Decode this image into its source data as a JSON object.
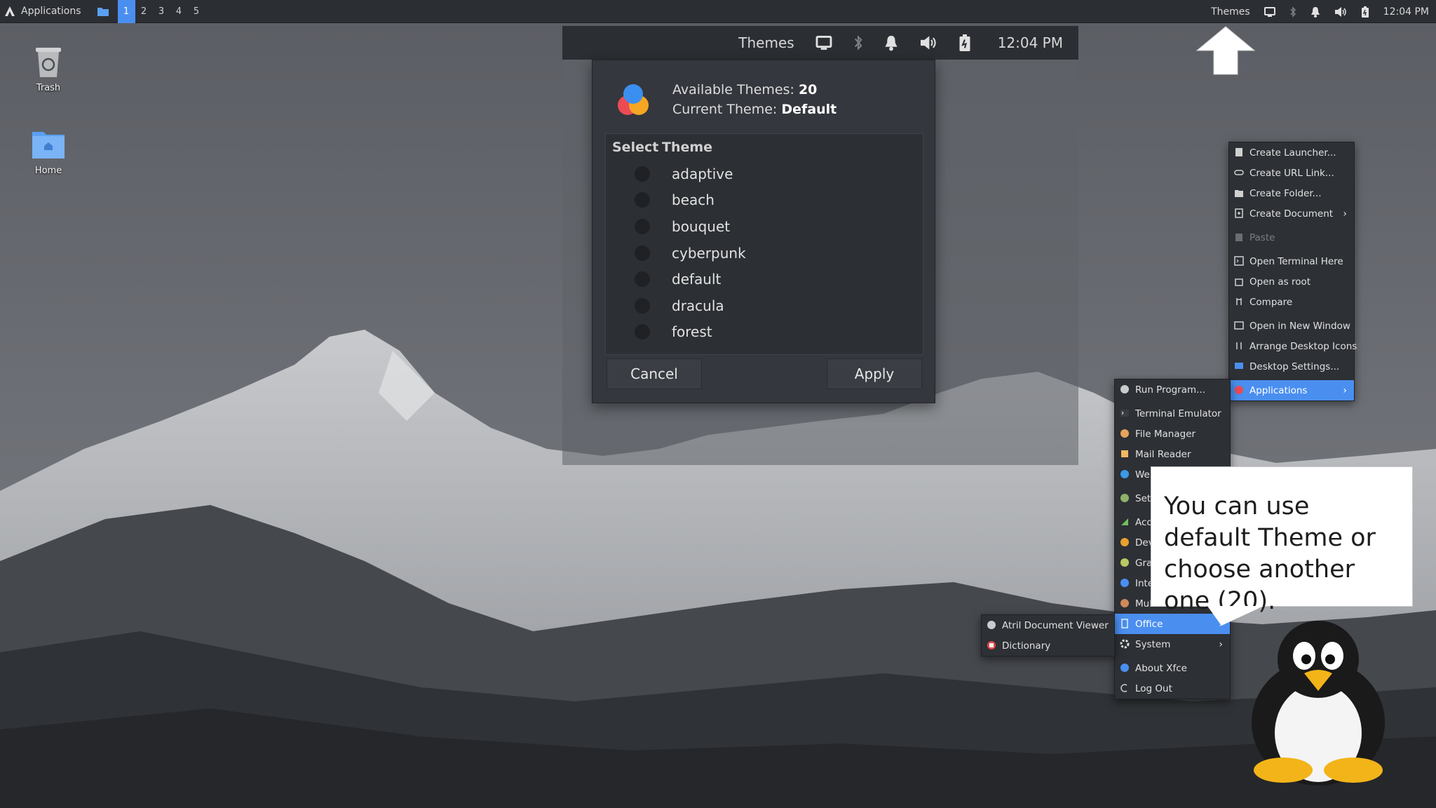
{
  "panel": {
    "applications_label": "Applications",
    "workspaces": [
      "1",
      "2",
      "3",
      "4",
      "5"
    ],
    "themes_label": "Themes",
    "clock": "12:04 PM",
    "icons": [
      "display-icon",
      "bluetooth-icon",
      "bell-icon",
      "volume-icon",
      "battery-icon"
    ]
  },
  "desktop": {
    "trash_label": "Trash",
    "home_label": "Home"
  },
  "zoom_panel": {
    "themes_label": "Themes",
    "clock": "12:04 PM"
  },
  "dialog": {
    "available_label": "Available Themes:",
    "available_count": "20",
    "current_label": "Current Theme:",
    "current_value": "Default",
    "col_select": "Select",
    "col_theme": "Theme",
    "themes": [
      "adaptive",
      "beach",
      "bouquet",
      "cyberpunk",
      "default",
      "dracula",
      "forest"
    ],
    "cancel_label": "Cancel",
    "apply_label": "Apply"
  },
  "desktop_menu": {
    "items": [
      {
        "label": "Create Launcher...",
        "icon": "launcher-icon"
      },
      {
        "label": "Create URL Link...",
        "icon": "link-icon"
      },
      {
        "label": "Create Folder...",
        "icon": "folder-icon"
      },
      {
        "label": "Create Document",
        "icon": "document-icon"
      },
      {
        "label": "Paste",
        "icon": "paste-icon"
      },
      {
        "label": "Open Terminal Here",
        "icon": "terminal-icon"
      },
      {
        "label": "Open as root",
        "icon": "root-icon"
      },
      {
        "label": "Compare",
        "icon": "compare-icon"
      },
      {
        "label": "Open in New Window",
        "icon": "window-icon"
      },
      {
        "label": "Arrange Desktop Icons",
        "icon": "arrange-icon"
      },
      {
        "label": "Desktop Settings...",
        "icon": "desktop-settings-icon"
      },
      {
        "label": "Applications",
        "icon": "applications-icon"
      }
    ]
  },
  "apps_menu": {
    "items": [
      {
        "label": "Run Program...",
        "icon": "run-icon"
      },
      {
        "label": "Terminal Emulator",
        "icon": "terminal-icon"
      },
      {
        "label": "File Manager",
        "icon": "file-manager-icon"
      },
      {
        "label": "Mail Reader",
        "icon": "mail-icon"
      },
      {
        "label": "Web",
        "icon": "web-icon"
      },
      {
        "label": "Sett",
        "icon": "settings-icon"
      },
      {
        "label": "Acce",
        "icon": "accessories-icon"
      },
      {
        "label": "Dev",
        "icon": "development-icon"
      },
      {
        "label": "Grap",
        "icon": "graphics-icon"
      },
      {
        "label": "Inte",
        "icon": "internet-icon"
      },
      {
        "label": "Mul",
        "icon": "multimedia-icon"
      },
      {
        "label": "Office",
        "icon": "office-icon"
      },
      {
        "label": "System",
        "icon": "system-icon"
      },
      {
        "label": "About Xfce",
        "icon": "about-icon"
      },
      {
        "label": "Log Out",
        "icon": "logout-icon"
      }
    ]
  },
  "office_menu": {
    "items": [
      {
        "label": "Atril Document Viewer",
        "icon": "document-viewer-icon"
      },
      {
        "label": "Dictionary",
        "icon": "dictionary-icon"
      }
    ]
  },
  "callout": {
    "text": "You can use default Theme or choose another one (20)."
  },
  "colors": {
    "accent": "#4a8ff0",
    "panel": "#2b2e33",
    "menu": "#2d3035",
    "dialog": "#34373d"
  }
}
